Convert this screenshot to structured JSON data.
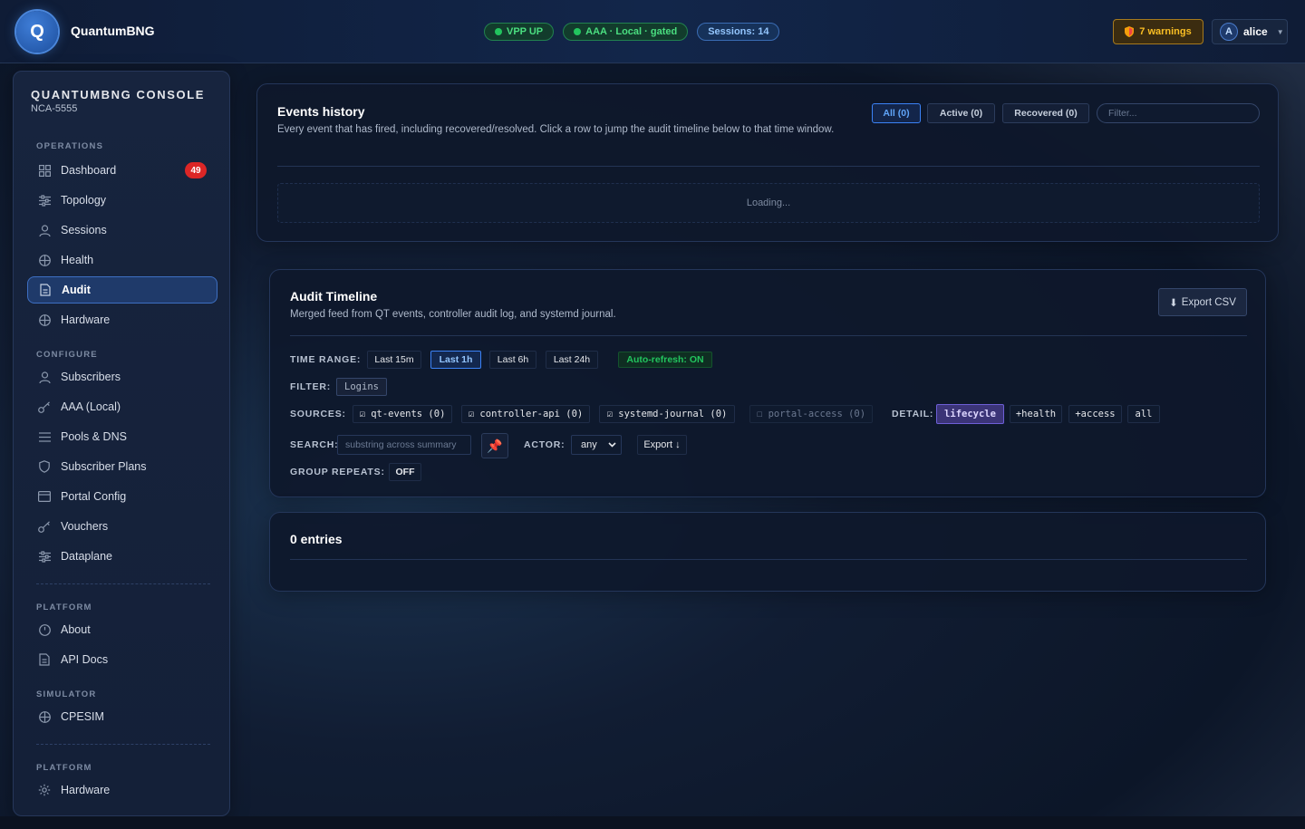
{
  "header": {
    "logo_letter": "Q",
    "brand": "QuantumBNG",
    "status_pills": [
      {
        "label": "VPP UP",
        "tone": "green"
      },
      {
        "label": "AAA · Local · gated",
        "tone": "green"
      },
      {
        "label": "Sessions: 14",
        "tone": "blue"
      }
    ],
    "warnings_label": "7 warnings",
    "user": {
      "initial": "A",
      "name": "alice"
    }
  },
  "sidebar": {
    "title": "QUANTUMBNG CONSOLE",
    "subtitle": "NCA-5555",
    "sections": {
      "operations": "OPERATIONS",
      "configure": "CONFIGURE",
      "platform": "PLATFORM",
      "simulator": "SIMULATOR",
      "platform2": "PLATFORM"
    },
    "items": [
      {
        "label": "Dashboard",
        "icon": "grid-icon",
        "badge": "49"
      },
      {
        "label": "Topology",
        "icon": "sliders-icon"
      },
      {
        "label": "Sessions",
        "icon": "user-icon"
      },
      {
        "label": "Health",
        "icon": "globe-icon"
      },
      {
        "label": "Audit",
        "icon": "document-icon",
        "active": true
      },
      {
        "label": "Hardware",
        "icon": "globe-icon"
      },
      {
        "label": "Subscribers",
        "icon": "user-icon"
      },
      {
        "label": "AAA (Local)",
        "icon": "key-icon"
      },
      {
        "label": "Pools & DNS",
        "icon": "list-icon"
      },
      {
        "label": "Subscriber Plans",
        "icon": "shield-icon"
      },
      {
        "label": "Portal Config",
        "icon": "window-icon"
      },
      {
        "label": "Vouchers",
        "icon": "key-icon"
      },
      {
        "label": "Dataplane",
        "icon": "sliders-icon"
      },
      {
        "label": "About",
        "icon": "clock-icon"
      },
      {
        "label": "API Docs",
        "icon": "document-icon"
      },
      {
        "label": "CPESIM",
        "icon": "globe-icon"
      },
      {
        "label": "Hardware",
        "icon": "gear-icon"
      }
    ]
  },
  "events": {
    "title": "Events history",
    "description": "Every event that has fired, including recovered/resolved. Click a row to jump the audit timeline below to that time window.",
    "tabs": [
      "All (0)",
      "Active (0)",
      "Recovered (0)"
    ],
    "filter_placeholder": "Filter...",
    "loading": "Loading..."
  },
  "audit": {
    "title": "Audit Timeline",
    "description": "Merged feed from QT events, controller audit log, and systemd journal.",
    "export_csv": "Export CSV",
    "time_range_label": "TIME RANGE:",
    "time_ranges": [
      "Last 15m",
      "Last 1h",
      "Last 6h",
      "Last 24h"
    ],
    "selected_range": "Last 1h",
    "auto_refresh": "Auto-refresh: ON",
    "filter_label": "FILTER:",
    "filter_tag": "Logins",
    "sources_label": "SOURCES:",
    "sources": [
      {
        "label": "☑ qt-events (0)",
        "checked": true
      },
      {
        "label": "☑ controller-api (0)",
        "checked": true
      },
      {
        "label": "☑ systemd-journal (0)",
        "checked": true
      },
      {
        "label": "☐ portal-access (0)",
        "checked": false
      }
    ],
    "detail_label": "DETAIL:",
    "details": [
      "lifecycle",
      "+health",
      "+access",
      "all"
    ],
    "search_label": "SEARCH:",
    "search_placeholder": "substring across summary",
    "actor_label": "ACTOR:",
    "actor_value": "any",
    "export_label": "Export ↓",
    "group_repeats_label": "GROUP REPEATS:",
    "group_repeats_value": "OFF"
  },
  "entries": {
    "title": "0 entries"
  }
}
